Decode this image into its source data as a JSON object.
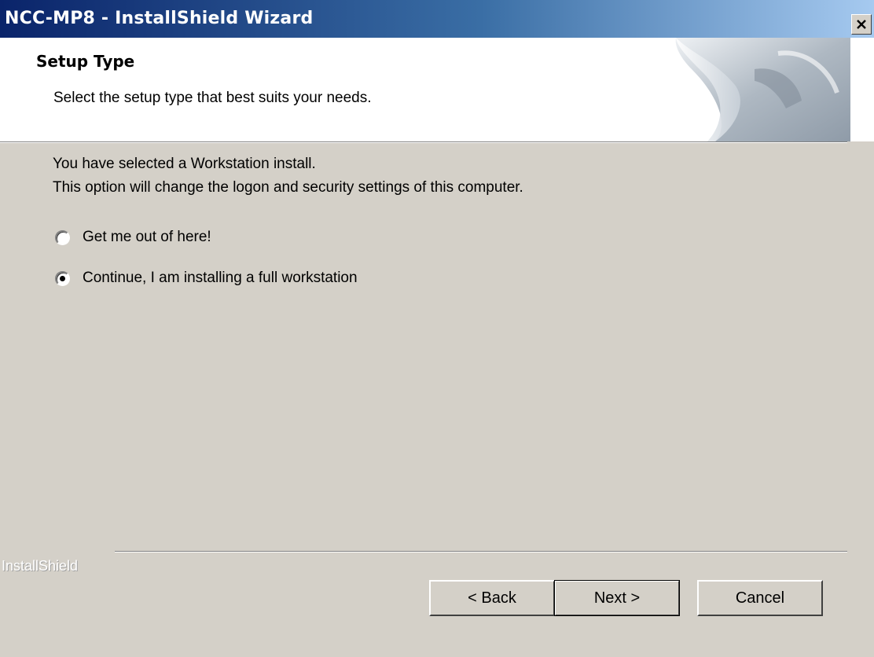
{
  "window": {
    "title": "NCC-MP8 - InstallShield Wizard",
    "close_glyph": "X"
  },
  "header": {
    "title": "Setup Type",
    "subtitle": "Select the setup type that best suits your needs.",
    "graphic_icon": "installshield-page-curl-graphic"
  },
  "body": {
    "info_line_1": "You have selected a Workstation install.",
    "info_line_2": "This option will change the logon and security settings of this computer.",
    "options": [
      {
        "label": "Get me out of here!",
        "selected": false
      },
      {
        "label": "Continue, I am installing a full workstation",
        "selected": true
      }
    ]
  },
  "footer": {
    "brand": "InstallShield",
    "back_label": "< Back",
    "next_label": "Next >",
    "cancel_label": "Cancel"
  },
  "colors": {
    "titlebar_start": "#0a246a",
    "titlebar_end": "#a6caf0",
    "dialog_face": "#d4d0c8",
    "header_bg": "#ffffff"
  }
}
